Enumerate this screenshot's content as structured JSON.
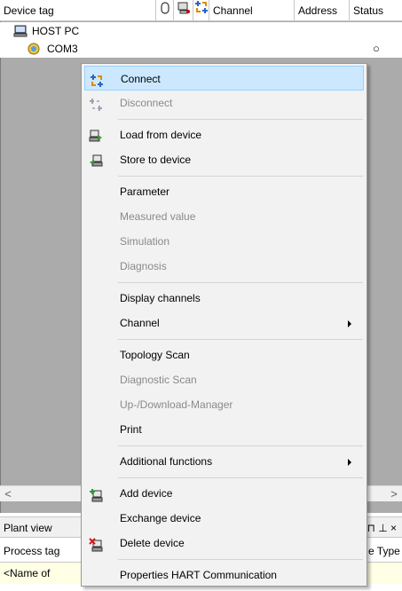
{
  "grid": {
    "columns": {
      "device_tag": "Device tag",
      "channel": "Channel",
      "address": "Address",
      "status": "Status"
    },
    "rows": [
      {
        "label": "HOST PC",
        "icon": "computer-icon"
      },
      {
        "label": "COM3",
        "icon": "com-port-icon",
        "status_indicator": "○"
      }
    ],
    "scroll_left": "<",
    "scroll_right": ">"
  },
  "plant_view": {
    "title": "Plant view",
    "pin": "⊓ ⊥ ×",
    "columns": {
      "process_tag": "Process tag",
      "device_type": "e Type"
    },
    "row_placeholder": "<Name of"
  },
  "context_menu": {
    "items": [
      {
        "label": "Connect",
        "enabled": true,
        "icon": "connect-icon",
        "highlighted": true
      },
      {
        "label": "Disconnect",
        "enabled": false,
        "icon": "disconnect-icon"
      },
      {
        "label": "Load from device",
        "enabled": true,
        "icon": "load-from-device-icon"
      },
      {
        "label": "Store to device",
        "enabled": true,
        "icon": "store-to-device-icon"
      },
      {
        "label": "Parameter",
        "enabled": true
      },
      {
        "label": "Measured value",
        "enabled": false
      },
      {
        "label": "Simulation",
        "enabled": false
      },
      {
        "label": "Diagnosis",
        "enabled": false
      },
      {
        "label": "Display channels",
        "enabled": true
      },
      {
        "label": "Channel",
        "enabled": true,
        "submenu": true
      },
      {
        "label": "Topology Scan",
        "enabled": true
      },
      {
        "label": "Diagnostic Scan",
        "enabled": false
      },
      {
        "label": "Up-/Download-Manager",
        "enabled": false
      },
      {
        "label": "Print",
        "enabled": true
      },
      {
        "label": "Additional functions",
        "enabled": true,
        "submenu": true
      },
      {
        "label": "Add device",
        "enabled": true,
        "icon": "add-device-icon"
      },
      {
        "label": "Exchange device",
        "enabled": true
      },
      {
        "label": "Delete device",
        "enabled": true,
        "icon": "delete-device-icon"
      },
      {
        "label": "Properties HART Communication",
        "enabled": true
      }
    ]
  },
  "colors": {
    "grid_background": "#ababab",
    "menu_background": "#f2f2f2",
    "menu_highlight": "#cce8ff",
    "disabled_text": "#8a8a8a",
    "plant_row_background": "#ffffe6"
  }
}
